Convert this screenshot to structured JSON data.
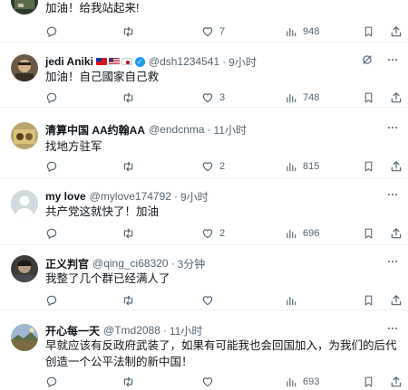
{
  "tweets": [
    {
      "name": "",
      "text": "加油！给我站起来!",
      "replies": "",
      "retweets": "",
      "likes": "7",
      "views": "948"
    },
    {
      "name": "jedi Aniki",
      "flags": [
        "taiwan",
        "usa",
        "japan"
      ],
      "verified": true,
      "handle": "@dsh1234541",
      "dot": "·",
      "time": "9小时",
      "text": "加油！自己國家自己救",
      "replies": "",
      "retweets": "",
      "likes": "3",
      "views": "748"
    },
    {
      "name": "清算中国 AA约翰AA",
      "handle": "@endcnma",
      "dot": "·",
      "time": "11小时",
      "text": "找地方驻军",
      "replies": "",
      "retweets": "",
      "likes": "2",
      "views": "815"
    },
    {
      "name": "my love",
      "handle": "@mylove174792",
      "dot": "·",
      "time": "9小时",
      "text": "共产党这就快了！加油",
      "replies": "",
      "retweets": "",
      "likes": "2",
      "views": "696"
    },
    {
      "name": "正义判官",
      "handle": "@qing_ci68320",
      "dot": "·",
      "time": "3分钟",
      "text": "我整了几个群已经满人了",
      "replies": "",
      "retweets": "",
      "likes": "",
      "views": ""
    },
    {
      "name": "开心每一天",
      "handle": "@Tmd2088",
      "dot": "·",
      "time": "11小时",
      "text": "早就应该有反政府武装了，如果有可能我也会回国加入，为我们的后代创造一个公平法制的新中国！",
      "replies": "",
      "retweets": "",
      "likes": "",
      "views": "693"
    }
  ],
  "icons": {
    "reply": "reply-icon",
    "retweet": "retweet-icon",
    "like": "heart-icon",
    "views": "views-icon",
    "bookmark": "bookmark-icon",
    "share": "share-icon",
    "grok": "grok-icon",
    "more": "more-icon"
  },
  "colors": {
    "text": "#0f1419",
    "muted": "#536471",
    "verified": "#1d9bf0",
    "divider": "#eff3f4"
  }
}
